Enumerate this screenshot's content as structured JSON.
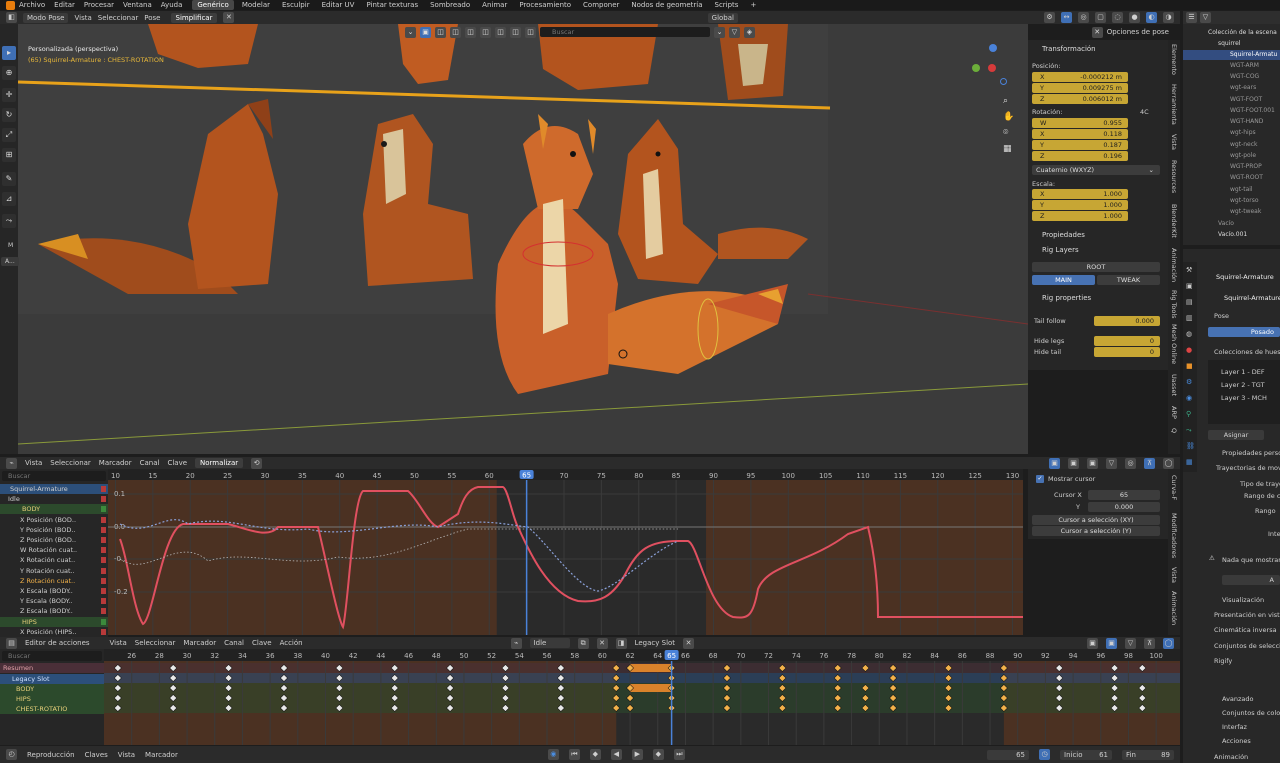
{
  "topbar": {
    "menus": [
      "Archivo",
      "Editar",
      "Procesar",
      "Ventana",
      "Ayuda"
    ],
    "workspaces": [
      "Genérico",
      "Modelar",
      "Esculpir",
      "Editar UV",
      "Pintar texturas",
      "Sombreado",
      "Animar",
      "Procesamiento",
      "Componer",
      "Nodos de geometría",
      "Scripts"
    ],
    "add_tab": "+"
  },
  "viewport": {
    "mode": "Modo Pose",
    "menus": [
      "Vista",
      "Seleccionar",
      "Pose"
    ],
    "simplify": "Simplificar",
    "transform_orientation": "Global",
    "overlay_title": "Personalizada (perspectiva)",
    "overlay_subtitle": "(65) Squirrel-Armature : CHEST-ROTATION",
    "search_placeholder": "Buscar",
    "pose_options": "Opciones de pose",
    "left_label_m": "M",
    "left_label_a": "A..."
  },
  "npanel": {
    "transform": "Transformación",
    "position_label": "Posición:",
    "position": [
      {
        "axis": "X",
        "value": "-0.000212 m"
      },
      {
        "axis": "Y",
        "value": "0.009275 m"
      },
      {
        "axis": "Z",
        "value": "0.006012 m"
      }
    ],
    "rotation_label": "Rotación:",
    "rotation_mode_short": "4C",
    "rotation": [
      {
        "axis": "W",
        "value": "0.955"
      },
      {
        "axis": "X",
        "value": "0.118"
      },
      {
        "axis": "Y",
        "value": "0.187"
      },
      {
        "axis": "Z",
        "value": "0.196"
      }
    ],
    "rotation_mode": "Cuaternio (WXYZ)",
    "scale_label": "Escala:",
    "scale": [
      {
        "axis": "X",
        "value": "1.000"
      },
      {
        "axis": "Y",
        "value": "1.000"
      },
      {
        "axis": "Z",
        "value": "1.000"
      }
    ],
    "properties": "Propiedades",
    "rig_layers": "Rig Layers",
    "layer_root": "ROOT",
    "layer_main": "MAIN",
    "layer_tweak": "TWEAK",
    "rig_properties": "Rig properties",
    "tail_follow_label": "Tail follow",
    "tail_follow": "0.000",
    "hide_legs_label": "Hide legs",
    "hide_legs": "0",
    "hide_tail_label": "Hide tail",
    "hide_tail": "0",
    "tabs": [
      "Elemento",
      "Herramienta",
      "Vista",
      "Resources",
      "BlenderKit",
      "Animación",
      "Rig Tools",
      "Mesh Online",
      "Uasset",
      "ARP",
      "Q"
    ]
  },
  "outliner": {
    "title": "Colección de la escena",
    "collection": "squirrel",
    "items": [
      "Squirrel-Armatu",
      "WGT-ARM",
      "WGT-COG",
      "wgt-ears",
      "WGT-FOOT",
      "WGT-FOOT.001",
      "WGT-HAND",
      "wgt-hips",
      "wgt-neck",
      "wgt-pole",
      "WGT-PROP",
      "WGT-ROOT",
      "wgt-tail",
      "wgt-torso",
      "wgt-tweak",
      "Vacío",
      "Vacío.001"
    ]
  },
  "properties": {
    "object_name": "Squirrel-Armature",
    "object_name2": "Squirrel-Armature",
    "pose_section": "Pose",
    "pose_button": "Posado",
    "bone_collections": "Colecciones de hueso",
    "layers": [
      "Layer 1 - DEF",
      "Layer 2 - TGT",
      "Layer 3 - MCH"
    ],
    "assign": "Asignar",
    "custom_props": "Propiedades perso",
    "motion_paths": "Trayectorias de movim",
    "path_type": "Tipo de trayec",
    "frame_range": "Rango de ci",
    "range": "Rango",
    "inte": "Inte",
    "nothing": "Nada que mostrar a",
    "a_btn": "A",
    "viz": "Visualización",
    "viewport_display": "Presentación en vista",
    "ik": "Cinemática inversa",
    "bone_sets": "Conjuntos de selecci",
    "rigify": "Rigify",
    "advanced": "Avanzado",
    "bone_sets2": "Conjuntos de color",
    "interface": "Interfaz",
    "actions": "Acciones",
    "animation": "Animación"
  },
  "graph": {
    "menus": [
      "Vista",
      "Seleccionar",
      "Marcador",
      "Canal",
      "Clave"
    ],
    "normalize": "Normalizar",
    "search_placeholder": "Buscar",
    "frame_ticks": [
      "10",
      "15",
      "20",
      "25",
      "30",
      "35",
      "40",
      "45",
      "50",
      "55",
      "60",
      "65",
      "70",
      "75",
      "80",
      "85",
      "90",
      "95",
      "100",
      "105",
      "110",
      "115",
      "120",
      "125",
      "130"
    ],
    "current_frame": "65",
    "y_ticks": [
      "0.1",
      "0.0",
      "-0.1",
      "-0.2"
    ],
    "channels": [
      {
        "label": "Squirrel-Armature",
        "kind": "object"
      },
      {
        "label": "Idle",
        "kind": "action"
      },
      {
        "label": "BODY",
        "kind": "group"
      },
      {
        "label": "X Posición (BOD..",
        "kind": "curve"
      },
      {
        "label": "Y Posición (BOD..",
        "kind": "curve"
      },
      {
        "label": "Z Posición (BOD..",
        "kind": "curve"
      },
      {
        "label": "W Rotación cuat..",
        "kind": "curve"
      },
      {
        "label": "X Rotación cuat..",
        "kind": "curve"
      },
      {
        "label": "Y Rotación cuat..",
        "kind": "curve"
      },
      {
        "label": "Z Rotación cuat..",
        "kind": "curve-active"
      },
      {
        "label": "X Escala (BODY..",
        "kind": "curve"
      },
      {
        "label": "Y Escala (BODY..",
        "kind": "curve"
      },
      {
        "label": "Z Escala (BODY..",
        "kind": "curve"
      },
      {
        "label": "HIPS",
        "kind": "group"
      },
      {
        "label": "X Posición (HIPS..",
        "kind": "curve"
      }
    ],
    "panel": {
      "show_cursor": "Mostrar cursor",
      "cursor_x_label": "Cursor X",
      "cursor_x": "65",
      "y_label": "Y",
      "y_val": "0.000",
      "to_sel_xy": "Cursor a selección (XY)",
      "to_sel_y": "Cursor a selección (Y)"
    },
    "tabs": [
      "Curva-F",
      "Modificadores",
      "Vista",
      "Animación"
    ]
  },
  "dopesheet": {
    "editor": "Editor de acciones",
    "menus": [
      "Vista",
      "Seleccionar",
      "Marcador",
      "Canal",
      "Clave",
      "Acción"
    ],
    "action": "Idle",
    "slot": "Legacy Slot",
    "search_placeholder": "Buscar",
    "frame_ticks": [
      "26",
      "28",
      "30",
      "32",
      "34",
      "36",
      "38",
      "40",
      "42",
      "44",
      "46",
      "48",
      "50",
      "52",
      "54",
      "56",
      "58",
      "60",
      "62",
      "64",
      "66",
      "68",
      "70",
      "72",
      "74",
      "76",
      "78",
      "80",
      "82",
      "84",
      "86",
      "88",
      "90",
      "92",
      "94",
      "96",
      "98",
      "100"
    ],
    "current_frame": "65",
    "rows": [
      "Resumen",
      "Legacy Slot",
      "BODY",
      "HIPS",
      "CHEST-ROTATIO"
    ]
  },
  "timeline": {
    "menus": [
      "Reproducción",
      "Claves",
      "Vista",
      "Marcador"
    ],
    "current": "65",
    "start_label": "Inicio",
    "start": "61",
    "end_label": "Fin",
    "end": "89"
  }
}
